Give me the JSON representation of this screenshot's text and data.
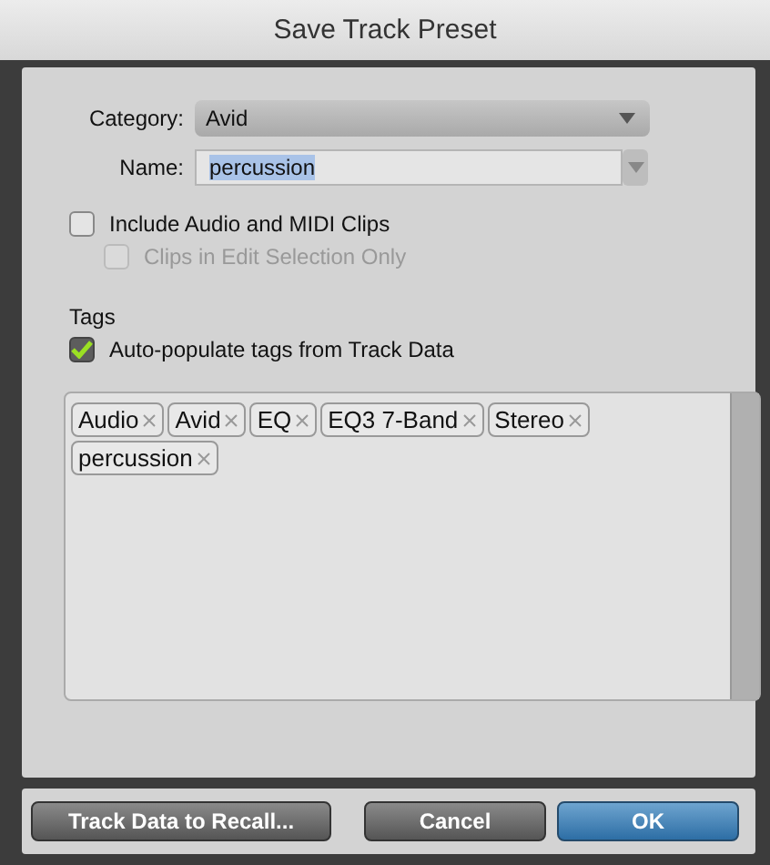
{
  "window": {
    "title": "Save Track Preset"
  },
  "category": {
    "label": "Category:",
    "value": "Avid"
  },
  "name": {
    "label": "Name:",
    "value": "percussion",
    "text_selected": true
  },
  "options": [
    {
      "label": "Include Audio and MIDI Clips",
      "checked": false,
      "disabled": false,
      "indented": false
    },
    {
      "label": "Clips in Edit Selection Only",
      "checked": false,
      "disabled": true,
      "indented": true
    }
  ],
  "tags_section": {
    "label": "Tags",
    "auto_populate": {
      "label": "Auto-populate tags from Track Data",
      "checked": true
    }
  },
  "tags": [
    "Audio",
    "Avid",
    "EQ",
    "EQ3 7-Band",
    "Stereo",
    "percussion"
  ],
  "buttons": [
    {
      "label": "Track Data to Recall...",
      "kind": "normal"
    },
    {
      "label": "Cancel",
      "kind": "normal"
    },
    {
      "label": "OK",
      "kind": "primary"
    }
  ]
}
